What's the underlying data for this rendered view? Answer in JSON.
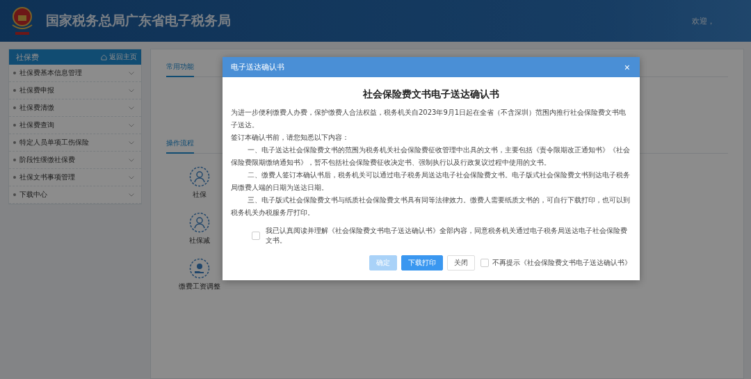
{
  "header": {
    "title": "国家税务总局广东省电子税务局",
    "welcome": "欢迎，"
  },
  "sidebar": {
    "title": "社保费",
    "home_link": "返回主页",
    "items": [
      {
        "label": "社保费基本信息管理"
      },
      {
        "label": "社保费申报"
      },
      {
        "label": "社保费清缴"
      },
      {
        "label": "社保费查询"
      },
      {
        "label": "特定人员单项工伤保险"
      },
      {
        "label": "阶段性缓缴社保费"
      },
      {
        "label": "社保文书事项管理"
      },
      {
        "label": "下载中心"
      }
    ]
  },
  "tabs": [
    {
      "label": "常用功能",
      "selected": true
    }
  ],
  "process": {
    "title": "操作流程",
    "nodes": [
      {
        "label": "社保",
        "kind": "person"
      },
      {
        "label": "社保减",
        "kind": "person"
      },
      {
        "label": "缴费工资调整",
        "kind": "hand"
      }
    ]
  },
  "dialog": {
    "title": "电子送达确认书",
    "close": "×",
    "heading": "社会保险费文书电子送达确认书",
    "paragraphs": [
      {
        "text": "为进一步便利缴费人办费，保护缴费人合法权益，税务机关自2023年9月1日起在全省（不含深圳）范围内推行社会保险费文书电子送达。",
        "indent": false
      },
      {
        "text": "签订本确认书前，请您知悉以下内容：",
        "indent": false
      },
      {
        "text": "一、电子送达社会保险费文书的范围为税务机关社会保险费征收管理中出具的文书，主要包括《责令限期改正通知书》《社会保险费限期缴纳通知书》，暂不包括社会保险费征收决定书、强制执行以及行政复议过程中使用的文书。",
        "indent": true
      },
      {
        "text": "二、缴费人签订本确认书后，税务机关可以通过电子税务局送达电子社会保险费文书。电子版式社会保险费文书到达电子税务局缴费人端的日期为送达日期。",
        "indent": true
      },
      {
        "text": "三、电子版式社会保险费文书与纸质社会保险费文书具有同等法律效力。缴费人需要纸质文书的，可自行下载打印，也可以到税务机关办税服务厅打印。",
        "indent": true
      }
    ],
    "agree": {
      "label": "我已认真阅读并理解《社会保险费文书电子送达确认书》全部内容，同意税务机关通过电子税务局送达电子社会保险费文书。",
      "checked": false
    },
    "buttons": [
      {
        "label": "确定",
        "kind": "primary",
        "disabled": true
      },
      {
        "label": "下载打印",
        "kind": "primary",
        "disabled": false
      },
      {
        "label": "关闭",
        "kind": "plain",
        "disabled": false
      }
    ],
    "dont_show": {
      "label": "不再提示《社会保险费文书电子送达确认书》",
      "checked": false
    }
  }
}
